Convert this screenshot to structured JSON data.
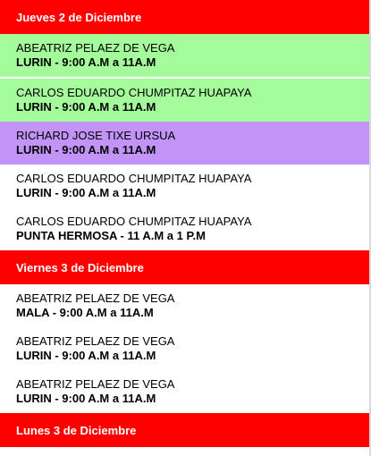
{
  "days": [
    {
      "header": "Jueves 2 de Diciembre",
      "entries": [
        {
          "name": "ABEATRIZ PELAEZ DE VEGA",
          "location": "LURIN",
          "time": "9:00 A.M a 11A.M",
          "color": "#a5fc9a"
        },
        {
          "name": "CARLOS EDUARDO CHUMPITAZ HUAPAYA",
          "location": "LURIN",
          "time": "9:00 A.M a 11A.M",
          "color": "#a5fc9a"
        },
        {
          "name": "RICHARD JOSE TIXE URSUA",
          "location": "LURIN",
          "time": "9:00 A.M a 11A.M",
          "color": "#c394f8"
        },
        {
          "name": "CARLOS EDUARDO CHUMPITAZ HUAPAYA",
          "location": "LURIN",
          "time": "9:00 A.M a 11A.M",
          "color": "#ffffff"
        },
        {
          "name": "CARLOS EDUARDO CHUMPITAZ HUAPAYA",
          "location": "PUNTA HERMOSA",
          "time": "11 A.M a 1 P.M",
          "color": "#ffffff"
        }
      ]
    },
    {
      "header": "Viernes 3 de Diciembre",
      "entries": [
        {
          "name": "ABEATRIZ PELAEZ DE VEGA",
          "location": "MALA",
          "time": "9:00 A.M a 11A.M",
          "color": "#ffffff"
        },
        {
          "name": "ABEATRIZ PELAEZ DE VEGA",
          "location": "LURIN",
          "time": "9:00 A.M a 11A.M",
          "color": "#ffffff"
        },
        {
          "name": "ABEATRIZ PELAEZ DE VEGA",
          "location": "LURIN",
          "time": "9:00 A.M a 11A.M",
          "color": "#ffffff"
        }
      ]
    },
    {
      "header": "Lunes 3 de Diciembre",
      "entries": []
    }
  ],
  "colors": {
    "header_bg": "#ff0000",
    "header_text": "#ffffff"
  }
}
